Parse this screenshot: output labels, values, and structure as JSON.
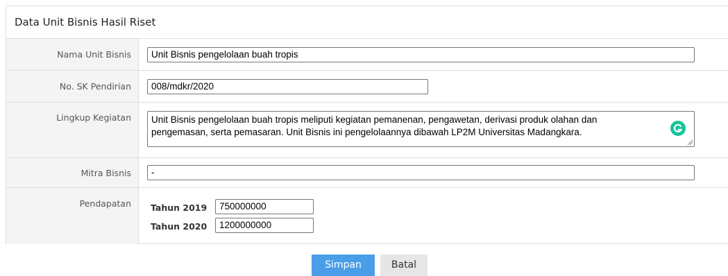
{
  "panel": {
    "title": "Data Unit Bisnis Hasil Riset"
  },
  "form": {
    "nama": {
      "label": "Nama Unit Bisnis",
      "value": "Unit Bisnis pengelolaan buah tropis"
    },
    "sk": {
      "label": "No. SK Pendirian",
      "value": "008/mdkr/2020"
    },
    "lingkup": {
      "label": "Lingkup Kegiatan",
      "value_line1": "Unit Bisnis pengelolaan buah tropis meliputi kegiatan pemanenan, pengawetan, derivasi produk olahan dan",
      "value_line2": "pengemasan, serta pemasaran. Unit Bisnis ini pengelolaannya dibawah LP2M Universitas Madangkara."
    },
    "mitra": {
      "label": "Mitra Bisnis",
      "value": "-"
    },
    "pendapatan": {
      "label": "Pendapatan",
      "tahun_2019": {
        "label": "Tahun 2019",
        "value": "750000000"
      },
      "tahun_2020": {
        "label": "Tahun 2020",
        "value": "1200000000"
      }
    }
  },
  "buttons": {
    "save": "Simpan",
    "cancel": "Batal"
  },
  "colors": {
    "primary": "#4a9ee8",
    "grammarly": "#15c39a",
    "label_bg": "#f4f4f4",
    "border": "#dddddd"
  },
  "icons": {
    "grammarly": "grammarly-icon",
    "resize": "resize-handle-icon"
  }
}
